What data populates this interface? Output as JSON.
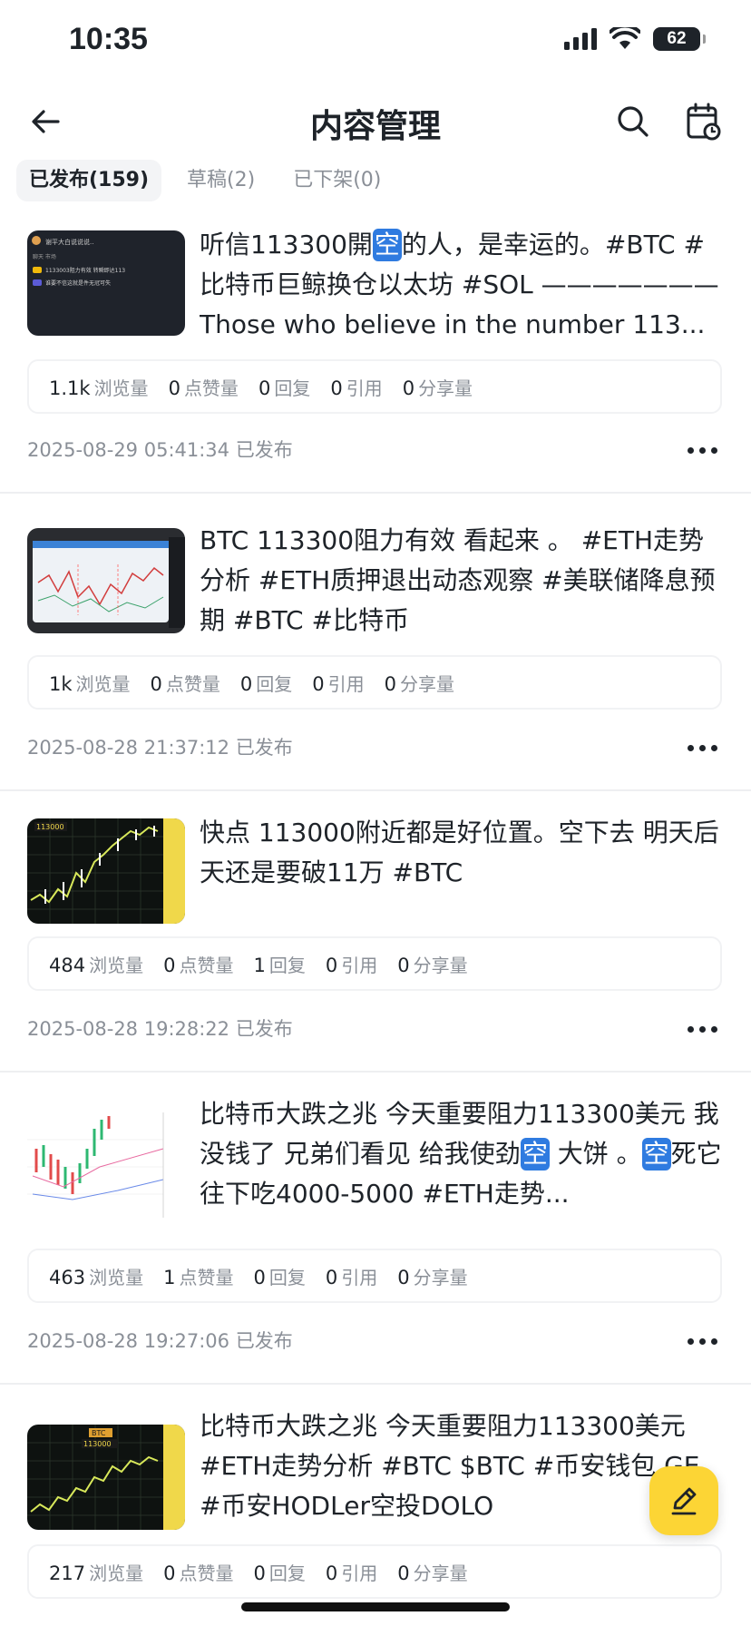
{
  "status_bar": {
    "time": "10:35",
    "battery": "62"
  },
  "header": {
    "title": "内容管理"
  },
  "tabs": [
    {
      "label": "已发布(159)"
    },
    {
      "label": "草稿(2)"
    },
    {
      "label": "已下架(0)"
    }
  ],
  "stat_labels": {
    "views": "浏览量",
    "likes": "点赞量",
    "replies": "回复",
    "quotes": "引用",
    "shares": "分享量"
  },
  "posts": [
    {
      "text_a": "听信113300開",
      "text_kong": "空",
      "text_b": "的人，是幸运的。#BTC #比特币巨鲸换仓以太坊 #SOL ——————— Those who believe in the number 113...",
      "thumb_lines": [
        "谢平大白说说说..",
        "聊天   市场",
        "1133003阻力有效 转瞬即达113",
        "谁要不信这就是件无冠可失"
      ],
      "views": "1.1k",
      "likes": "0",
      "replies": "0",
      "quotes": "0",
      "shares": "0",
      "date": "2025-08-29 05:41:34 已发布"
    },
    {
      "text": "BTC 113300阻力有效 看起来 。 #ETH走势分析 #ETH质押退出动态观察 #美联储降息预期 #BTC #比特币",
      "views": "1k",
      "likes": "0",
      "replies": "0",
      "quotes": "0",
      "shares": "0",
      "date": "2025-08-28 21:37:12 已发布"
    },
    {
      "text": "快点 113000附近都是好位置。空下去 明天后天还是要破11万 #BTC",
      "thumb_label": "113000",
      "views": "484",
      "likes": "0",
      "replies": "1",
      "quotes": "0",
      "shares": "0",
      "date": "2025-08-28 19:28:22 已发布"
    },
    {
      "text_a": "比特币大跌之兆 今天重要阻力113300美元 我没钱了 兄弟们看见 给我使劲",
      "text_kong": "空",
      "text_b": " 大饼 。",
      "text_kong2": "空",
      "text_c": "死它 往下吃4000-5000 #ETH走势...",
      "views": "463",
      "likes": "1",
      "replies": "0",
      "quotes": "0",
      "shares": "0",
      "date": "2025-08-28 19:27:06 已发布"
    },
    {
      "text": "比特币大跌之兆 今天重要阻力113300美元 #ETH走势分析 #BTC $BTC #币安钱包 GE #币安HODLer空投DOLO",
      "thumb_label": "113000",
      "thumb_label2": "BTC",
      "views": "217",
      "likes": "0",
      "replies": "0",
      "quotes": "0",
      "shares": "0"
    }
  ],
  "icons": {
    "back": "arrow-left-icon",
    "search": "search-icon",
    "calendar": "calendar-clock-icon",
    "more": "more-horizontal-icon",
    "compose": "pen-icon"
  },
  "colors": {
    "accent": "#fcd535",
    "kong_badge": "#2f7be0",
    "muted": "#8a8f97"
  }
}
